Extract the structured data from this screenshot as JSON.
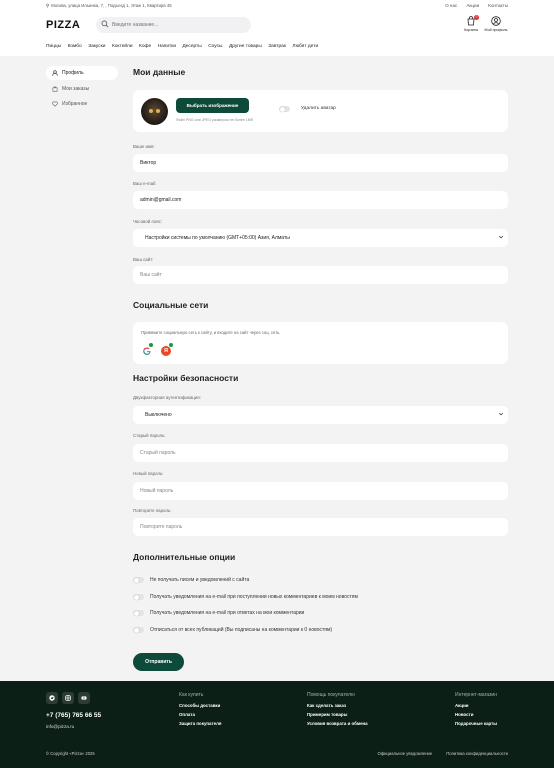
{
  "header": {
    "address": "Москва, улица Ильинка, 7, , Подъезд 1, Этаж 1, Квартира 45",
    "top_links": [
      "О нас",
      "Акции",
      "Контакты"
    ],
    "logo": "PIZZA",
    "search_placeholder": "Введите название...",
    "cart_label": "Корзина",
    "cart_count": "0",
    "profile_label": "Мой профиль",
    "nav": [
      "Пиццы",
      "Комбо",
      "Закуски",
      "Коктейли",
      "Кофе",
      "Напитки",
      "Десерты",
      "Соусы",
      "Другие товары",
      "Завтрак",
      "Любят дети"
    ]
  },
  "sidebar": {
    "items": [
      {
        "label": "Профиль",
        "icon": "user-icon",
        "active": true
      },
      {
        "label": "Мои заказы",
        "icon": "box-icon",
        "active": false
      },
      {
        "label": "Избранное",
        "icon": "heart-icon",
        "active": false
      }
    ]
  },
  "profile": {
    "title": "Мои данные",
    "upload_button": "Выбрать изображение",
    "upload_hint": "Файл PNG или JPEG размером не более 1Мб",
    "delete_avatar": "Удалить аватар",
    "name_label": "Ваше имя:",
    "name_value": "Виктор",
    "email_label": "Ваш e-mail:",
    "email_value": "admin@gmail.com",
    "tz_label": "Часовой пояс:",
    "tz_value": "Настройки системы по умолчанию (GMT+05:00) Азия, Алматы",
    "site_label": "Ваш сайт:",
    "site_placeholder": "Ваш сайт"
  },
  "social": {
    "title": "Социальные сети",
    "text": "Привяжите социальную сеть к сайту, и входите на сайт через соц. сеть."
  },
  "security": {
    "title": "Настройки безопасности",
    "twofa_label": "Двухфакторная аутентификация:",
    "twofa_value": "Выключено",
    "old_label": "Старый пароль:",
    "old_placeholder": "Старый пароль",
    "new_label": "Новый пароль:",
    "new_placeholder": "Новый пароль",
    "repeat_label": "Повторите пароль:",
    "repeat_placeholder": "Повторите пароль"
  },
  "options": {
    "title": "Дополнительные опции",
    "items": [
      "Не получать писем и уведомлений с сайта",
      "Получать уведомления на e-mail при поступлении новых комментариев к моим новостям",
      "Получать уведомления на e-mail при ответах на мои комментарии",
      "Отписаться от всех публикаций (Вы подписаны на комментарии к 0 новостям)"
    ],
    "submit": "Отправить"
  },
  "footer": {
    "phone": "+7 (765) 765 66 55",
    "email": "info@pizza.ru",
    "col1": {
      "title": "Как купить",
      "links": [
        "Способы доставки",
        "Оплата",
        "Защита покупателя"
      ]
    },
    "col2": {
      "title": "Помощь покупателю",
      "links": [
        "Как сделать заказ",
        "Примерим товары",
        "Условия возврата и обмена"
      ]
    },
    "col3": {
      "title": "Интернет-магазин",
      "links": [
        "Акции",
        "Новости",
        "Подарочные карты"
      ]
    },
    "copyright": "© Copyright «Pizza» 2025",
    "agreement": "Официальное уведомление",
    "privacy": "Политика конфиденциальности"
  },
  "colors": {
    "accent": "#0d4a3a",
    "footer_bg": "#0b1f16",
    "page_bg": "#f3f3f3"
  }
}
